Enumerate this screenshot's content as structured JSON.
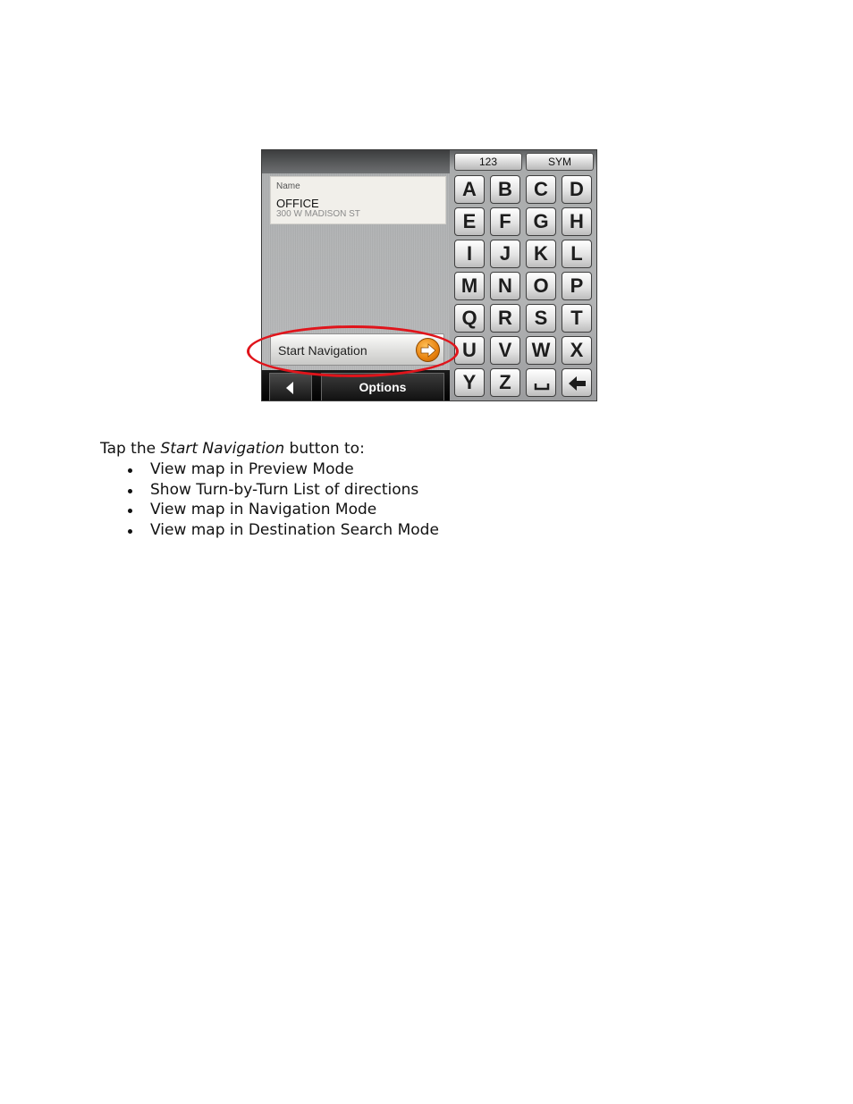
{
  "screen": {
    "keyboard_modes": [
      "123",
      "SYM"
    ],
    "keys": [
      "A",
      "B",
      "C",
      "D",
      "E",
      "F",
      "G",
      "H",
      "I",
      "J",
      "K",
      "L",
      "M",
      "N",
      "O",
      "P",
      "Q",
      "R",
      "S",
      "T",
      "U",
      "V",
      "W",
      "X",
      "Y",
      "Z"
    ],
    "space_key_icon": "space-icon",
    "backspace_key_icon": "backspace-arrow-icon",
    "name_card": {
      "label": "Name",
      "value": "OFFICE",
      "address": "300 W MADISON ST"
    },
    "start_navigation_label": "Start Navigation",
    "start_navigation_icon": "right-arrow-icon",
    "back_icon": "back-triangle-icon",
    "options_label": "Options",
    "highlight_color": "#e0141b",
    "accent_color": "#e8820e"
  },
  "text": {
    "intro_prefix": "Tap the ",
    "intro_emphasis": "Start Navigation",
    "intro_suffix": " button to:",
    "bullets": [
      "View map in Preview Mode",
      "Show Turn-by-Turn List of directions",
      "View map in Navigation Mode",
      "View map in Destination Search Mode"
    ]
  }
}
